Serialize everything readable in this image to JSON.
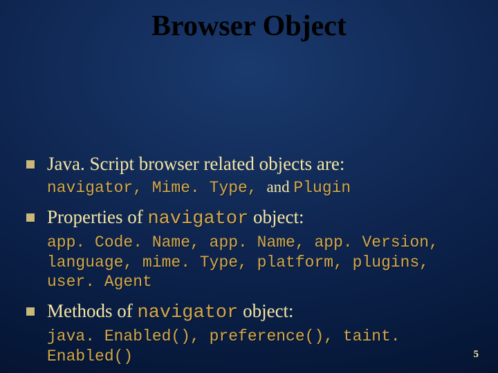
{
  "title": "Browser Object",
  "bullets": [
    {
      "main": "Java. Script browser related objects are:",
      "sub_pre": "navigator, Mime. Type, ",
      "sub_mid": "and ",
      "sub_post": "Plugin"
    },
    {
      "main_pre": "Properties of ",
      "main_code": "navigator",
      "main_post": " object:",
      "sub": "app. Code. Name, app. Name, app. Version, language, mime. Type, platform, plugins, user. Agent"
    },
    {
      "main_pre": "Methods of ",
      "main_code": "navigator",
      "main_post": " object:",
      "sub": "java. Enabled(), preference(), taint. Enabled()"
    }
  ],
  "slide_number": "5"
}
